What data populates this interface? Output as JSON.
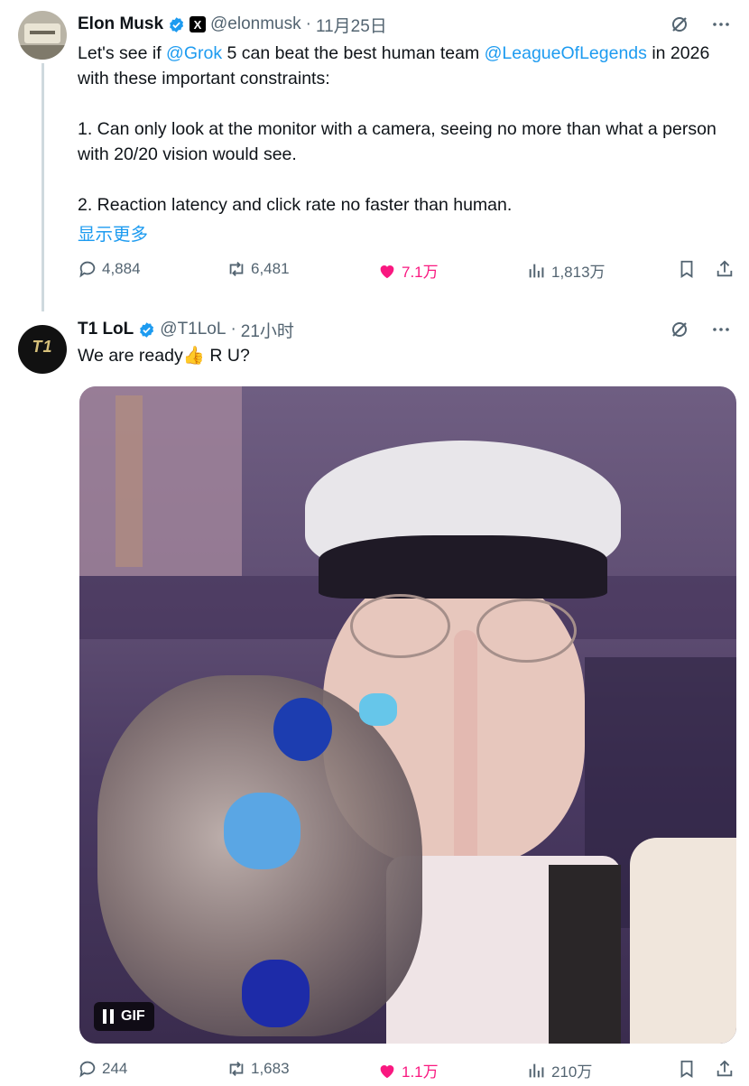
{
  "tweets": [
    {
      "author": "Elon Musk",
      "handle": "@elonmusk",
      "separator": "·",
      "time": "11月25日",
      "badge_text": "X",
      "text": {
        "p1_a": "Let's see if ",
        "p1_mention1": "@Grok",
        "p1_b": " 5 can beat the best human team ",
        "p1_mention2": "@LeagueOfLegends",
        "p1_c": " in 2026 with these important constraints:",
        "p2": "1. Can only look at the monitor with a camera, seeing no more than what a person with 20/20 vision would see.",
        "p3": "2. Reaction latency and click rate no faster than human."
      },
      "show_more": "显示更多",
      "stats": {
        "replies": "4,884",
        "reposts": "6,481",
        "likes": "7.1万",
        "views": "1,813万"
      }
    },
    {
      "author": "T1 LoL",
      "handle": "@T1LoL",
      "separator": "·",
      "time": "21小时",
      "logo_text": "T1",
      "text": {
        "a": "We are ready",
        "emoji": "👍",
        "b": " R U?"
      },
      "media": {
        "badge": "GIF"
      },
      "stats": {
        "replies": "244",
        "reposts": "1,683",
        "likes": "1.1万",
        "views": "210万"
      }
    }
  ],
  "colors": {
    "link": "#1d9bf0",
    "like": "#f91880",
    "muted": "#536471",
    "verified": "#1d9bf0"
  },
  "icons": [
    "verified-icon",
    "grok-icon",
    "more-icon",
    "reply-icon",
    "repost-icon",
    "like-icon",
    "views-icon",
    "bookmark-icon",
    "share-icon"
  ]
}
